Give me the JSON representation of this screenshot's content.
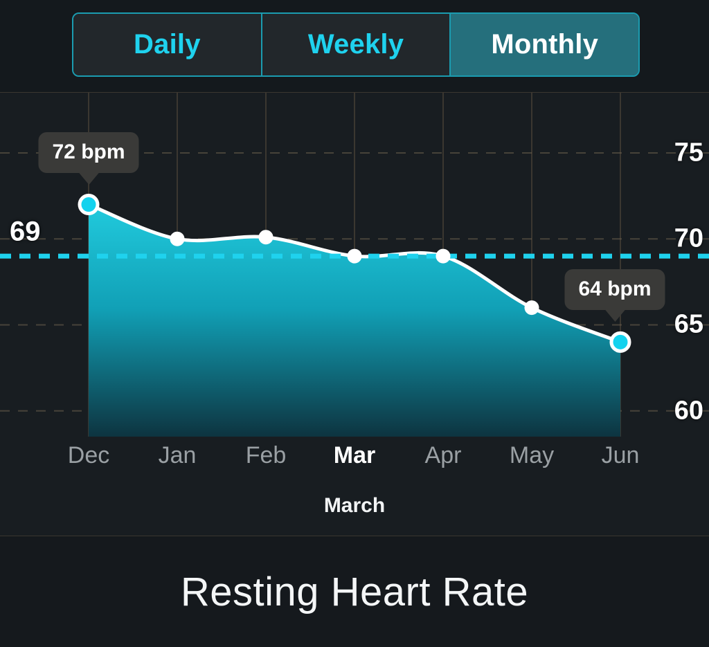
{
  "segmented_control": {
    "name": "time-range-selector",
    "options": [
      {
        "label": "Daily",
        "selected": false
      },
      {
        "label": "Weekly",
        "selected": false
      },
      {
        "label": "Monthly",
        "selected": true
      }
    ],
    "accent_color": "#1fd2ee",
    "selected_bg": "#256f7c",
    "border_color": "#1b9cb0"
  },
  "footer": {
    "title": "Resting Heart Rate"
  },
  "chart_data": {
    "type": "area",
    "title": "Resting Heart Rate",
    "subtitle": "March",
    "xlabel": "March",
    "ylabel": "",
    "categories": [
      "Dec",
      "Jan",
      "Feb",
      "Mar",
      "Apr",
      "May",
      "Jun"
    ],
    "values": [
      72,
      70,
      70.1,
      69,
      69,
      66,
      64
    ],
    "highlighted_category": "Mar",
    "ylim": [
      58.5,
      78.5
    ],
    "yticks": [
      75,
      70,
      65,
      60
    ],
    "ytick_labels": [
      "75",
      "70",
      "65",
      "60"
    ],
    "grid": true,
    "legend": "none",
    "reference_line": {
      "value": 69,
      "label": "69",
      "style": "dashed",
      "color": "#1fd2ee"
    },
    "annotations": [
      {
        "category": "Dec",
        "value": 72,
        "label": "72 bpm"
      },
      {
        "category": "Jun",
        "value": 64,
        "label": "64 bpm"
      }
    ],
    "series_colors": {
      "line": "#ffffff",
      "area_top": "#1ec8dc",
      "area_bottom": "#0d3440",
      "marker_fill": "#ffffff",
      "marker_highlight_fill": "#13d2ee"
    }
  }
}
